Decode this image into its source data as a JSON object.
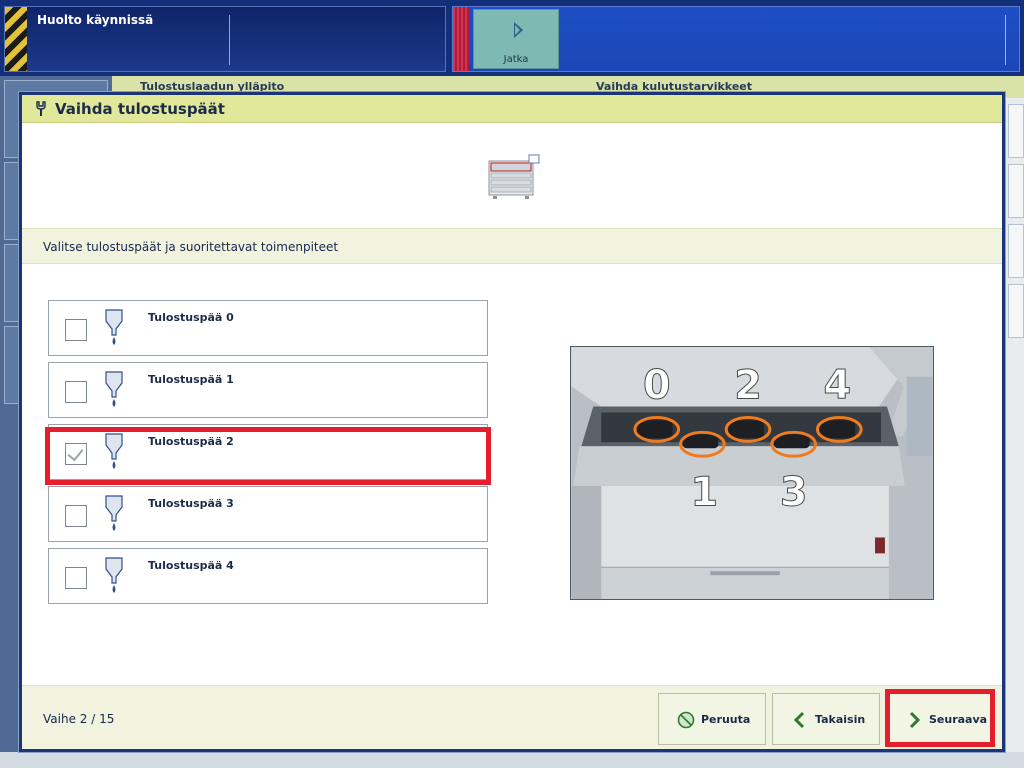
{
  "status_bar": {
    "title": "Huolto käynnissä"
  },
  "job_bar": {
    "continue_label": "Jatka"
  },
  "background_tabs": [
    "Tulostuslaadun ylläpito",
    "Vaihda kulutustarvikkeet"
  ],
  "dialog": {
    "title": "Vaihda tulostuspäät",
    "instruction": "Valitse tulostuspäät ja suoritettavat toimenpiteet",
    "print_heads": [
      {
        "label": "Tulostuspää 0",
        "checked": false
      },
      {
        "label": "Tulostuspää 1",
        "checked": false
      },
      {
        "label": "Tulostuspää 2",
        "checked": true
      },
      {
        "label": "Tulostuspää 3",
        "checked": false
      },
      {
        "label": "Tulostuspää 4",
        "checked": false
      }
    ],
    "photo_labels": {
      "top": [
        "0",
        "2",
        "4"
      ],
      "bottom": [
        "1",
        "3"
      ]
    },
    "step": "Vaihe 2 / 15",
    "buttons": {
      "cancel": "Peruuta",
      "back": "Takaisin",
      "next": "Seuraava"
    }
  },
  "colors": {
    "highlight": "#e41e2d",
    "header": "#e2e89a",
    "topbar": "#132f7a"
  }
}
